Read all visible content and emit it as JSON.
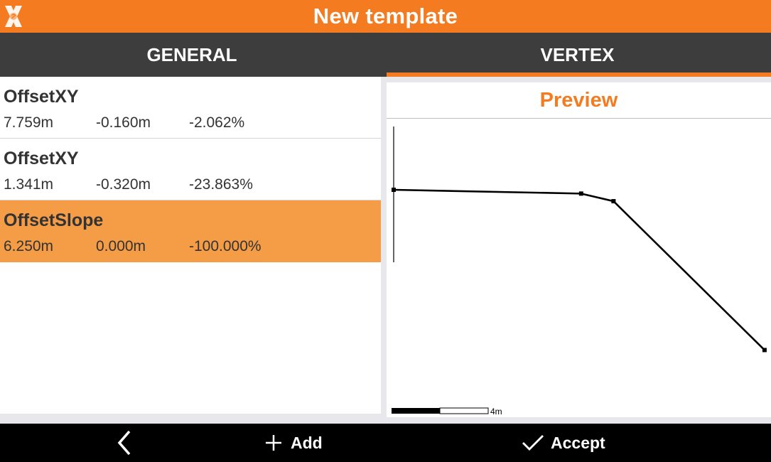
{
  "header": {
    "title": "New template",
    "logo_icon": "app-logo-icon"
  },
  "tabs": [
    {
      "label": "GENERAL",
      "active": false
    },
    {
      "label": "VERTEX",
      "active": true
    }
  ],
  "vertices": [
    {
      "name": "OffsetXY",
      "offset": "7.759m",
      "height": "-0.160m",
      "slope": "-2.062%",
      "selected": false
    },
    {
      "name": "OffsetXY",
      "offset": "1.341m",
      "height": "-0.320m",
      "slope": "-23.863%",
      "selected": false
    },
    {
      "name": "OffsetSlope",
      "offset": "6.250m",
      "height": "0.000m",
      "slope": "-100.000%",
      "selected": true
    }
  ],
  "preview": {
    "title": "Preview",
    "scale_label": "4m",
    "profile_points": [
      {
        "x": 0,
        "y": 0
      },
      {
        "x": 7.759,
        "y": -0.16
      },
      {
        "x": 9.1,
        "y": -0.48
      },
      {
        "x": 15.35,
        "y": -6.73
      }
    ]
  },
  "bottom": {
    "back_icon": "chevron-left-icon",
    "add_icon": "plus-icon",
    "add_label": "Add",
    "accept_icon": "check-icon",
    "accept_label": "Accept"
  },
  "colors": {
    "accent": "#f47b20",
    "selected_row": "#f59c46",
    "tabbar": "#3d3d3d",
    "bottombar": "#000000"
  }
}
